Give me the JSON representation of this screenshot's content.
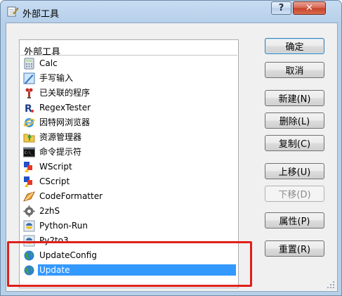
{
  "window": {
    "title": "外部工具",
    "help_label": "?",
    "close_label": "✕"
  },
  "list": {
    "header": "外部工具",
    "items": [
      {
        "label": "Calc",
        "icon": "calculator-icon"
      },
      {
        "label": "手写输入",
        "icon": "handwriting-icon"
      },
      {
        "label": "已关联的程序",
        "icon": "associated-program-icon"
      },
      {
        "label": "RegexTester",
        "icon": "regex-icon"
      },
      {
        "label": "因特网浏览器",
        "icon": "internet-explorer-icon"
      },
      {
        "label": "资源管理器",
        "icon": "explorer-icon"
      },
      {
        "label": "命令提示符",
        "icon": "command-prompt-icon"
      },
      {
        "label": "WScript",
        "icon": "script-icon"
      },
      {
        "label": "CScript",
        "icon": "script-icon"
      },
      {
        "label": "CodeFormatter",
        "icon": "code-formatter-icon"
      },
      {
        "label": "2zhS",
        "icon": "gear-icon"
      },
      {
        "label": "Python-Run",
        "icon": "python-icon"
      },
      {
        "label": "Py2to3",
        "icon": "python-icon"
      },
      {
        "label": "UpdateConfig",
        "icon": "globe-icon"
      },
      {
        "label": "Update",
        "icon": "globe-icon",
        "selected": true
      }
    ]
  },
  "buttons": {
    "ok": "确定",
    "cancel": "取消",
    "new": "新建(N)",
    "delete": "删除(L)",
    "copy": "复制(C)",
    "move_up": "上移(U)",
    "move_down": "下移(D)",
    "properties": "属性(P)",
    "reset": "重置(R)"
  },
  "colors": {
    "selection": "#3399ff",
    "highlight_box": "#e0201b"
  }
}
